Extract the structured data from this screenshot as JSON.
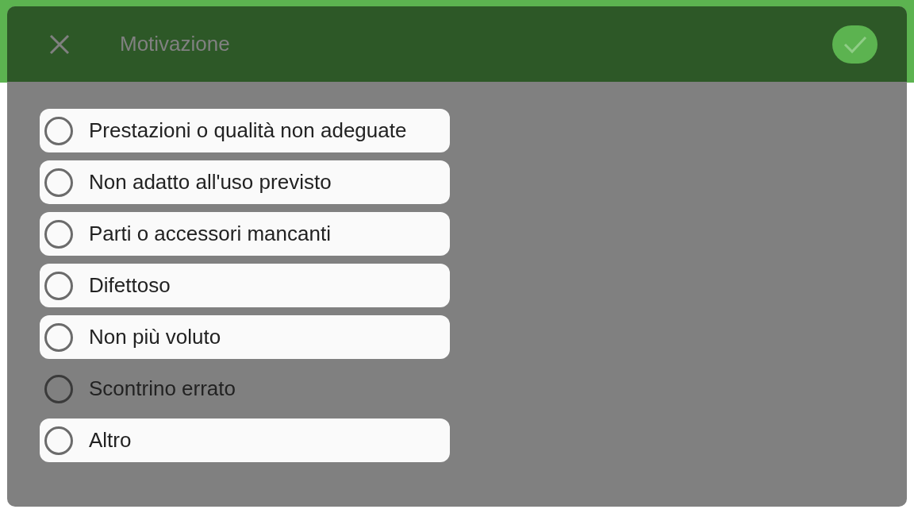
{
  "dialog": {
    "title": "Motivazione",
    "options": [
      {
        "label": "Prestazioni o qualità non adeguate",
        "selected": false,
        "highlighted": true
      },
      {
        "label": "Non adatto all'uso previsto",
        "selected": false,
        "highlighted": true
      },
      {
        "label": "Parti o accessori mancanti",
        "selected": false,
        "highlighted": true
      },
      {
        "label": "Difettoso",
        "selected": false,
        "highlighted": true
      },
      {
        "label": "Non più voluto",
        "selected": false,
        "highlighted": true
      },
      {
        "label": "Scontrino errato",
        "selected": false,
        "highlighted": false
      },
      {
        "label": "Altro",
        "selected": false,
        "highlighted": true
      }
    ]
  }
}
